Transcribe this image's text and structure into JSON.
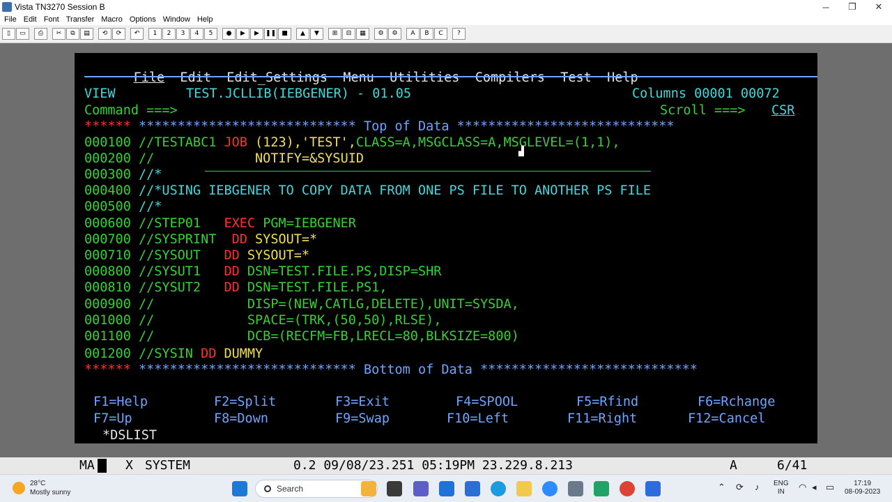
{
  "window": {
    "title": "Vista TN3270 Session B",
    "minimize": "─",
    "maximize": "❐",
    "close": "✕"
  },
  "menu": [
    "File",
    "Edit",
    "Font",
    "Transfer",
    "Macro",
    "Options",
    "Window",
    "Help"
  ],
  "toolbar": {
    "seg1": [
      "▯",
      "▭"
    ],
    "seg2": [
      "⎙"
    ],
    "seg3": [
      "✂",
      "⧉",
      "▤"
    ],
    "seg4": [
      "⟲",
      "⟳"
    ],
    "seg5": [
      "↶"
    ],
    "seg6": [
      "1",
      "2",
      "3",
      "4",
      "5"
    ],
    "seg7": [
      "●",
      "▶",
      "▶",
      "❚❚",
      "■"
    ],
    "seg8": [
      "▲",
      "▼"
    ],
    "seg9": [
      "⊞",
      "⊟",
      "▦"
    ],
    "seg10": [
      "⚙",
      "⚙"
    ],
    "seg11": [
      "A",
      "B",
      "C"
    ],
    "seg12": [
      "?"
    ]
  },
  "ispf": {
    "menu": [
      "File",
      "Edit",
      "Edit_Settings",
      "Menu",
      "Utilities",
      "Compilers",
      "Test",
      "Help"
    ],
    "mode": "VIEW",
    "dataset": "TEST.JCLLIB(IEBGENER) - 01.05",
    "columns": "Columns 00001 00072",
    "command_label": "Command ===>",
    "scroll_label": "Scroll ===>",
    "scroll_value": "CSR",
    "top_marker": "******",
    "top_stars_left": "****************************",
    "top_text": " Top of Data ",
    "top_stars_right": "****************************",
    "bottom_marker": "******",
    "bottom_stars_left": "****************************",
    "bottom_text": " Bottom of Data ",
    "bottom_stars_right": "****************************",
    "lines": {
      "l1": {
        "num": "000100",
        "a": "//TESTABC1 ",
        "b": "JOB",
        "c": " (123),'TEST',",
        "d": "CLASS=A,MSGCLASS=A,MSGLEVEL=(1,1),",
        "e": ""
      },
      "l2": {
        "num": "000200",
        "a": "//",
        "pad": "             ",
        "b": "NOTIFY=&SYSUID"
      },
      "l3": {
        "num": "000300",
        "a": "//*"
      },
      "l4": {
        "num": "000400",
        "a": "//*USING IEBGENER TO COPY DATA FROM ONE PS FILE TO ANOTHER PS FILE"
      },
      "l5": {
        "num": "000500",
        "a": "//*"
      },
      "l6": {
        "num": "000600",
        "a": "//STEP01   ",
        "b": "EXEC",
        "c": " PGM=IEBGENER"
      },
      "l7": {
        "num": "000700",
        "a": "//SYSPRINT  ",
        "b": "DD",
        "c": " SYSOUT=*"
      },
      "l8": {
        "num": "000710",
        "a": "//SYSOUT   ",
        "b": "DD",
        "c": " SYSOUT=*"
      },
      "l9": {
        "num": "000800",
        "a": "//SYSUT1   ",
        "b": "DD",
        "c": " DSN=TEST.FILE.PS,DISP=SHR"
      },
      "l10": {
        "num": "000810",
        "a": "//SYSUT2   ",
        "b": "DD",
        "c": " DSN=TEST.FILE.PS1,"
      },
      "l11": {
        "num": "000900",
        "a": "//",
        "pad": "            ",
        "c": "DISP=(NEW,CATLG,DELETE),UNIT=SYSDA,"
      },
      "l12": {
        "num": "001000",
        "a": "//",
        "pad": "            ",
        "c": "SPACE=(TRK,(50,50),RLSE),"
      },
      "l13": {
        "num": "001100",
        "a": "//",
        "pad": "            ",
        "c": "DCB=(RECFM=FB,LRECL=80,BLKSIZE=800)"
      },
      "l14": {
        "num": "001200",
        "a": "//SYSIN ",
        "b": "DD",
        "c": " DUMMY"
      }
    },
    "fkeys": {
      "f1": "F1=Help",
      "f2": "F2=Split",
      "f3": "F3=Exit",
      "f4": "F4=SPOOL",
      "f5": "F5=Rfind",
      "f6": "F6=Rchange",
      "f7": "F7=Up",
      "f8": "F8=Down",
      "f9": "F9=Swap",
      "f10": "F10=Left",
      "f11": "F11=Right",
      "f12": "F12=Cancel"
    },
    "bottom_cmd": "*DSLIST"
  },
  "oia": {
    "ma": "MA",
    "x": "X",
    "system": "SYSTEM",
    "info": "0.2 09/08/23.251 05:19PM 23.229.8.213",
    "a": "A",
    "pos": "6/41"
  },
  "taskbar": {
    "temp": "28°C",
    "weather": "Mostly sunny",
    "search": "Search",
    "lang1": "ENG",
    "lang2": "IN",
    "time": "17:19",
    "date": "08-09-2023"
  },
  "colors": {
    "terminal_bg": "#000000",
    "green": "#33d133",
    "blue": "#6fa4ff",
    "red": "#ff3030",
    "yellow": "#f0e050"
  }
}
